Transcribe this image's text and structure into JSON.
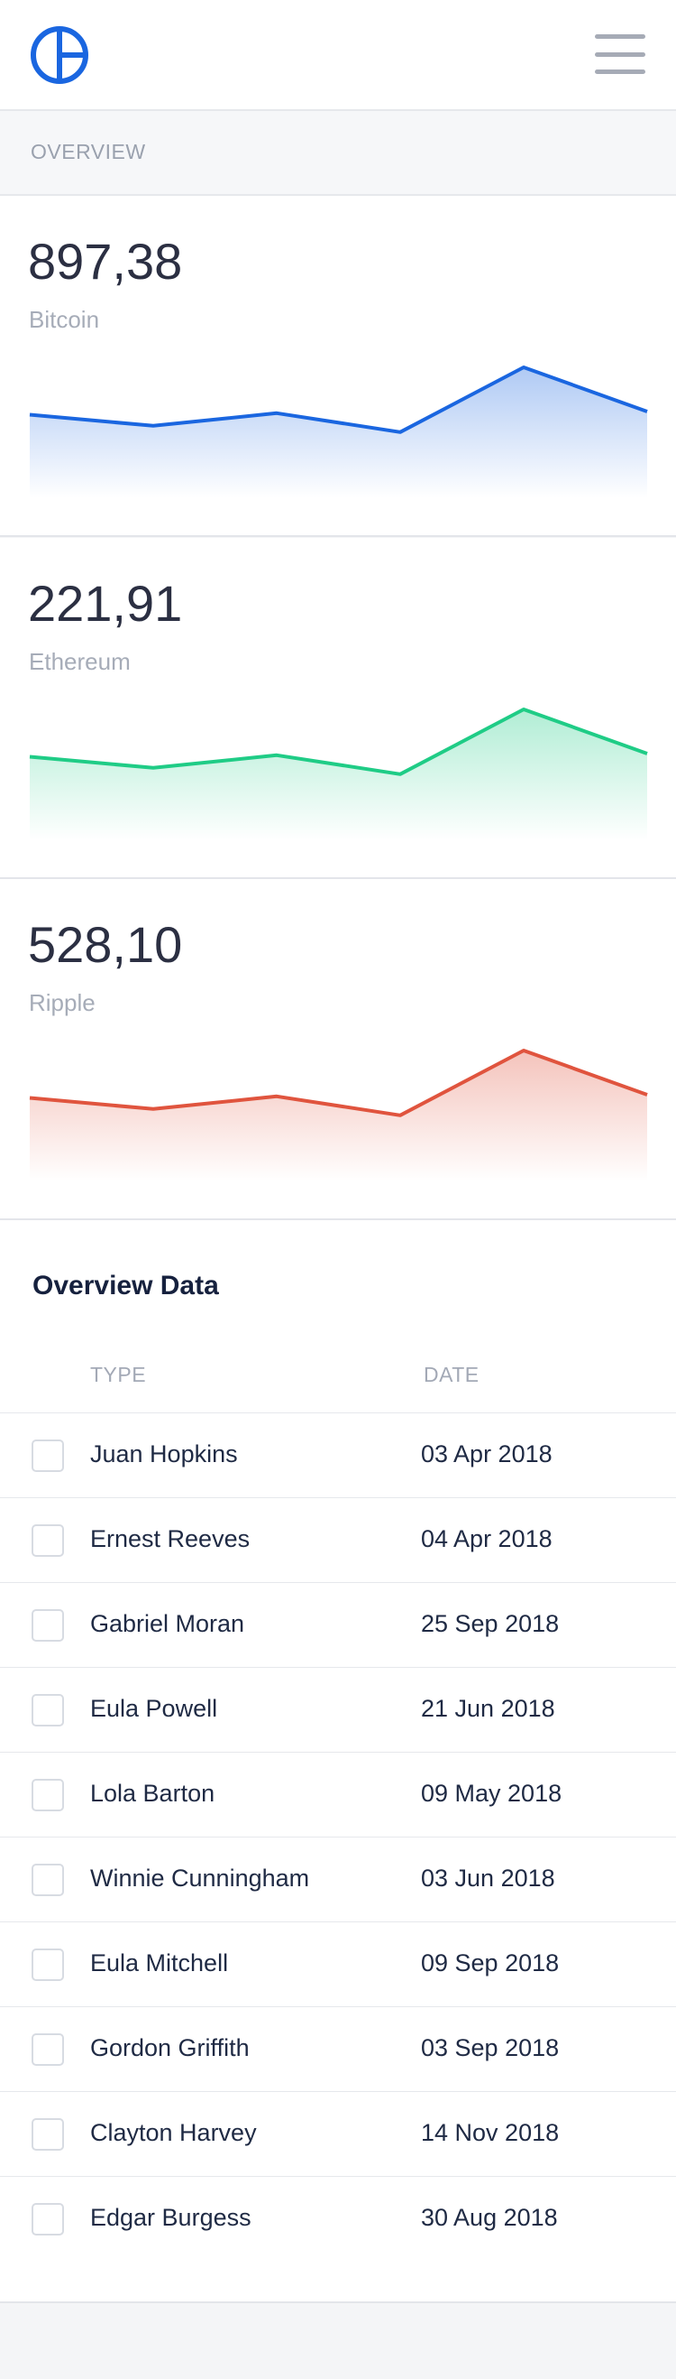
{
  "colors": {
    "brand": "#1a66e0",
    "bitcoin": "#1a66e0",
    "ethereum": "#1fcc86",
    "ripple": "#e0543e"
  },
  "header": {
    "logo_icon": "pie-logo-icon",
    "menu_icon": "hamburger-menu-icon"
  },
  "section": {
    "title": "OVERVIEW"
  },
  "cards": [
    {
      "value": "897,38",
      "label": "Bitcoin",
      "chart_data": {
        "type": "area",
        "values": [
          50,
          43,
          51,
          39,
          80,
          52
        ]
      }
    },
    {
      "value": "221,91",
      "label": "Ethereum",
      "chart_data": {
        "type": "area",
        "values": [
          50,
          43,
          51,
          39,
          80,
          52
        ]
      }
    },
    {
      "value": "528,10",
      "label": "Ripple",
      "chart_data": {
        "type": "area",
        "values": [
          50,
          43,
          51,
          39,
          80,
          52
        ]
      }
    }
  ],
  "table": {
    "title": "Overview Data",
    "columns": [
      "TYPE",
      "DATE"
    ],
    "rows": [
      {
        "name": "Juan Hopkins",
        "date": "03 Apr 2018"
      },
      {
        "name": "Ernest Reeves",
        "date": "04 Apr 2018"
      },
      {
        "name": "Gabriel Moran",
        "date": "25 Sep 2018"
      },
      {
        "name": "Eula Powell",
        "date": "21 Jun 2018"
      },
      {
        "name": "Lola Barton",
        "date": "09 May 2018"
      },
      {
        "name": "Winnie Cunningham",
        "date": "03 Jun 2018"
      },
      {
        "name": "Eula Mitchell",
        "date": "09 Sep 2018"
      },
      {
        "name": "Gordon Griffith",
        "date": "03 Sep 2018"
      },
      {
        "name": "Clayton Harvey",
        "date": "14 Nov 2018"
      },
      {
        "name": "Edgar Burgess",
        "date": "30 Aug 2018"
      }
    ]
  }
}
